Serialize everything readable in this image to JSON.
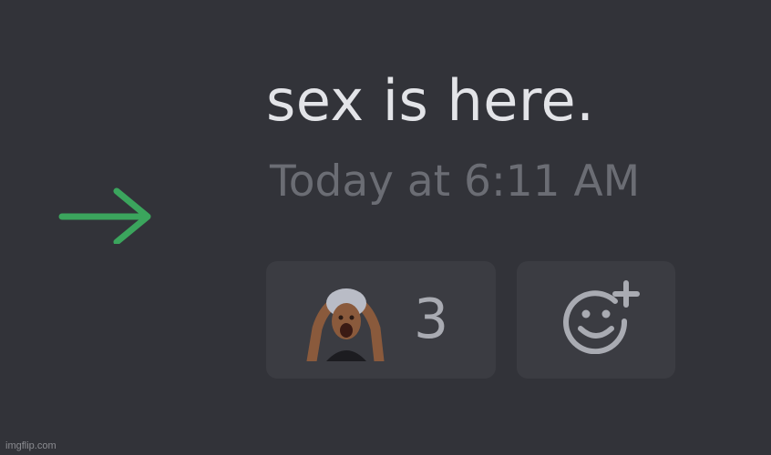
{
  "message": {
    "text": "sex is here.",
    "timestamp": "Today at 6:11 AM"
  },
  "join_indicator": {
    "icon": "arrow-right-icon",
    "color": "#3ba55d"
  },
  "reactions": [
    {
      "emoji_name": "shocked-person-emoji",
      "count": "3"
    }
  ],
  "add_reaction": {
    "icon": "add-reaction-icon"
  },
  "watermark": {
    "text": "imgflip.com"
  },
  "colors": {
    "background": "#323339",
    "reaction_bg": "#3b3c42",
    "message_text": "#e3e4e8",
    "timestamp_text": "#6b6d74",
    "accent_green": "#3ba55d"
  }
}
